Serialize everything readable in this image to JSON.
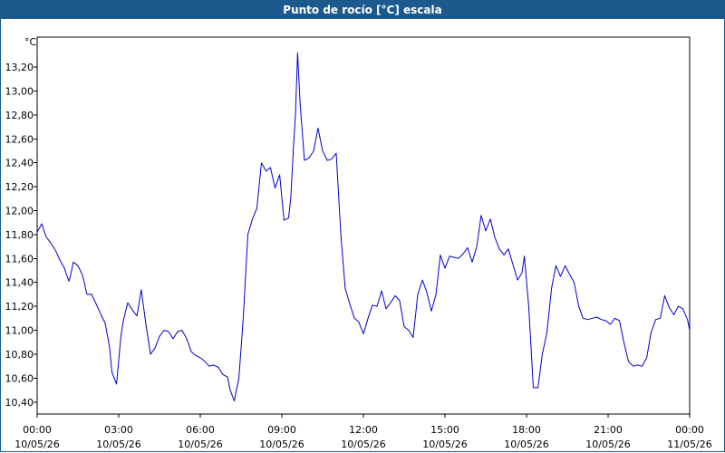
{
  "window": {
    "title": "Punto de rocío [°C] escala"
  },
  "chart_data": {
    "type": "line",
    "title": "Punto de rocío [°C] escala",
    "ylabel": "°C",
    "xlabel": "",
    "ylim": [
      10.3,
      13.45
    ],
    "xlim": [
      0,
      24
    ],
    "grid": true,
    "colors": {
      "line": "#0000cc",
      "grid": "#000000",
      "axis": "#000000"
    },
    "y_ticks": [
      {
        "value": 10.4,
        "label": "10,40"
      },
      {
        "value": 10.6,
        "label": "10,60"
      },
      {
        "value": 10.8,
        "label": "10,80"
      },
      {
        "value": 11.0,
        "label": "11,00"
      },
      {
        "value": 11.2,
        "label": "11,20"
      },
      {
        "value": 11.4,
        "label": "11,40"
      },
      {
        "value": 11.6,
        "label": "11,60"
      },
      {
        "value": 11.8,
        "label": "11,80"
      },
      {
        "value": 12.0,
        "label": "12,00"
      },
      {
        "value": 12.2,
        "label": "12,20"
      },
      {
        "value": 12.4,
        "label": "12,40"
      },
      {
        "value": 12.6,
        "label": "12,60"
      },
      {
        "value": 12.8,
        "label": "12,80"
      },
      {
        "value": 13.0,
        "label": "13,00"
      },
      {
        "value": 13.2,
        "label": "13,20"
      }
    ],
    "x_ticks": [
      {
        "value": 0,
        "time": "00:00",
        "date": "10/05/26"
      },
      {
        "value": 3,
        "time": "03:00",
        "date": "10/05/26"
      },
      {
        "value": 6,
        "time": "06:00",
        "date": "10/05/26"
      },
      {
        "value": 9,
        "time": "09:00",
        "date": "10/05/26"
      },
      {
        "value": 12,
        "time": "12:00",
        "date": "10/05/26"
      },
      {
        "value": 15,
        "time": "15:00",
        "date": "10/05/26"
      },
      {
        "value": 18,
        "time": "18:00",
        "date": "10/05/26"
      },
      {
        "value": 21,
        "time": "21:00",
        "date": "10/05/26"
      },
      {
        "value": 24,
        "time": "00:00",
        "date": "11/05/26"
      }
    ],
    "series": [
      {
        "values": [
          [
            0.0,
            11.82
          ],
          [
            0.17,
            11.89
          ],
          [
            0.33,
            11.78
          ],
          [
            0.5,
            11.73
          ],
          [
            0.67,
            11.67
          ],
          [
            0.83,
            11.59
          ],
          [
            1.0,
            11.52
          ],
          [
            1.07,
            11.47
          ],
          [
            1.17,
            11.41
          ],
          [
            1.25,
            11.48
          ],
          [
            1.33,
            11.57
          ],
          [
            1.5,
            11.54
          ],
          [
            1.67,
            11.46
          ],
          [
            1.83,
            11.3
          ],
          [
            2.0,
            11.3
          ],
          [
            2.17,
            11.22
          ],
          [
            2.33,
            11.14
          ],
          [
            2.5,
            11.06
          ],
          [
            2.67,
            10.85
          ],
          [
            2.75,
            10.65
          ],
          [
            2.92,
            10.55
          ],
          [
            3.0,
            10.75
          ],
          [
            3.08,
            10.95
          ],
          [
            3.17,
            11.08
          ],
          [
            3.33,
            11.23
          ],
          [
            3.5,
            11.17
          ],
          [
            3.67,
            11.12
          ],
          [
            3.83,
            11.34
          ],
          [
            4.0,
            11.05
          ],
          [
            4.17,
            10.8
          ],
          [
            4.33,
            10.85
          ],
          [
            4.5,
            10.95
          ],
          [
            4.67,
            11.0
          ],
          [
            4.83,
            10.99
          ],
          [
            5.0,
            10.93
          ],
          [
            5.17,
            10.99
          ],
          [
            5.33,
            11.0
          ],
          [
            5.5,
            10.93
          ],
          [
            5.67,
            10.82
          ],
          [
            5.83,
            10.79
          ],
          [
            6.0,
            10.77
          ],
          [
            6.17,
            10.74
          ],
          [
            6.33,
            10.7
          ],
          [
            6.5,
            10.71
          ],
          [
            6.67,
            10.69
          ],
          [
            6.83,
            10.63
          ],
          [
            7.0,
            10.61
          ],
          [
            7.1,
            10.5
          ],
          [
            7.25,
            10.41
          ],
          [
            7.42,
            10.6
          ],
          [
            7.58,
            11.1
          ],
          [
            7.75,
            11.8
          ],
          [
            7.92,
            11.93
          ],
          [
            8.08,
            12.02
          ],
          [
            8.25,
            12.4
          ],
          [
            8.42,
            12.33
          ],
          [
            8.58,
            12.36
          ],
          [
            8.75,
            12.19
          ],
          [
            8.92,
            12.3
          ],
          [
            9.08,
            11.92
          ],
          [
            9.25,
            11.94
          ],
          [
            9.33,
            12.11
          ],
          [
            9.42,
            12.5
          ],
          [
            9.5,
            12.8
          ],
          [
            9.58,
            13.32
          ],
          [
            9.67,
            12.9
          ],
          [
            9.83,
            12.42
          ],
          [
            10.0,
            12.44
          ],
          [
            10.17,
            12.5
          ],
          [
            10.33,
            12.69
          ],
          [
            10.5,
            12.5
          ],
          [
            10.67,
            12.42
          ],
          [
            10.83,
            12.43
          ],
          [
            11.0,
            12.48
          ],
          [
            11.17,
            11.8
          ],
          [
            11.33,
            11.35
          ],
          [
            11.5,
            11.22
          ],
          [
            11.67,
            11.1
          ],
          [
            11.83,
            11.07
          ],
          [
            12.0,
            10.97
          ],
          [
            12.17,
            11.1
          ],
          [
            12.33,
            11.21
          ],
          [
            12.5,
            11.2
          ],
          [
            12.67,
            11.33
          ],
          [
            12.83,
            11.18
          ],
          [
            13.0,
            11.23
          ],
          [
            13.17,
            11.29
          ],
          [
            13.33,
            11.25
          ],
          [
            13.5,
            11.03
          ],
          [
            13.67,
            11.0
          ],
          [
            13.83,
            10.94
          ],
          [
            14.0,
            11.3
          ],
          [
            14.17,
            11.42
          ],
          [
            14.33,
            11.32
          ],
          [
            14.5,
            11.16
          ],
          [
            14.67,
            11.3
          ],
          [
            14.83,
            11.63
          ],
          [
            15.0,
            11.52
          ],
          [
            15.17,
            11.62
          ],
          [
            15.33,
            11.61
          ],
          [
            15.5,
            11.6
          ],
          [
            15.67,
            11.64
          ],
          [
            15.83,
            11.69
          ],
          [
            16.0,
            11.57
          ],
          [
            16.17,
            11.7
          ],
          [
            16.33,
            11.96
          ],
          [
            16.5,
            11.83
          ],
          [
            16.67,
            11.93
          ],
          [
            16.83,
            11.78
          ],
          [
            17.0,
            11.68
          ],
          [
            17.17,
            11.63
          ],
          [
            17.33,
            11.68
          ],
          [
            17.5,
            11.55
          ],
          [
            17.67,
            11.42
          ],
          [
            17.83,
            11.48
          ],
          [
            17.92,
            11.62
          ],
          [
            18.08,
            11.2
          ],
          [
            18.25,
            10.52
          ],
          [
            18.42,
            10.52
          ],
          [
            18.58,
            10.8
          ],
          [
            18.75,
            10.98
          ],
          [
            18.92,
            11.35
          ],
          [
            19.08,
            11.54
          ],
          [
            19.25,
            11.45
          ],
          [
            19.42,
            11.54
          ],
          [
            19.58,
            11.47
          ],
          [
            19.75,
            11.4
          ],
          [
            19.92,
            11.2
          ],
          [
            20.08,
            11.1
          ],
          [
            20.25,
            11.09
          ],
          [
            20.42,
            11.1
          ],
          [
            20.58,
            11.11
          ],
          [
            20.75,
            11.09
          ],
          [
            20.92,
            11.08
          ],
          [
            21.08,
            11.05
          ],
          [
            21.25,
            11.1
          ],
          [
            21.42,
            11.08
          ],
          [
            21.58,
            10.9
          ],
          [
            21.75,
            10.74
          ],
          [
            21.92,
            10.7
          ],
          [
            22.08,
            10.71
          ],
          [
            22.25,
            10.7
          ],
          [
            22.42,
            10.77
          ],
          [
            22.58,
            10.98
          ],
          [
            22.75,
            11.09
          ],
          [
            22.92,
            11.1
          ],
          [
            23.08,
            11.29
          ],
          [
            23.25,
            11.19
          ],
          [
            23.42,
            11.13
          ],
          [
            23.58,
            11.2
          ],
          [
            23.75,
            11.18
          ],
          [
            23.92,
            11.09
          ],
          [
            24.0,
            11.0
          ]
        ]
      }
    ]
  }
}
